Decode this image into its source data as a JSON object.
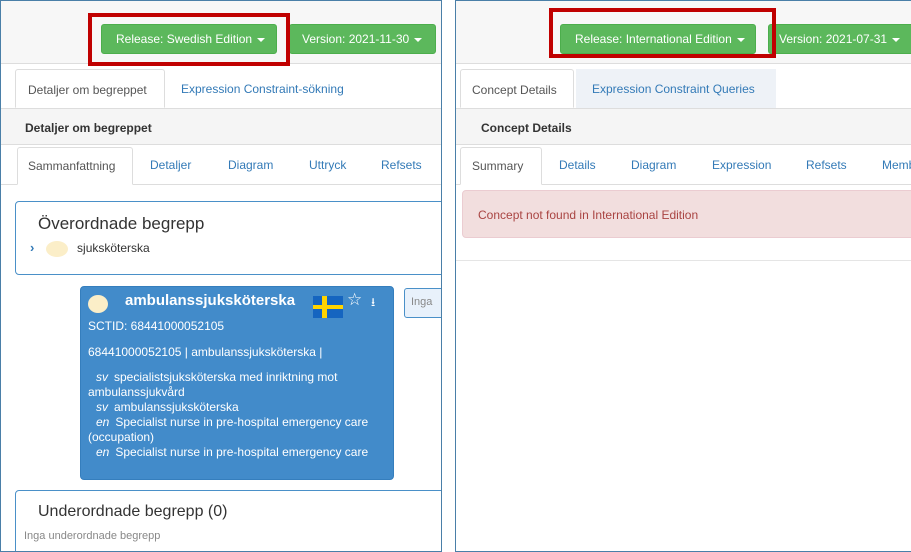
{
  "left": {
    "release_button": "Release: Swedish Edition",
    "version_button": "Version: 2021-11-30",
    "tabs": [
      "Detaljer om begreppet",
      "Expression Constraint-sökning"
    ],
    "section_header": "Detaljer om begreppet",
    "subtabs": [
      "Sammanfattning",
      "Detaljer",
      "Diagram",
      "Uttryck",
      "Refsets"
    ],
    "parents_title": "Överordnade begrepp",
    "parent_item": "sjuksköterska",
    "concept": {
      "name": "ambulanssjuksköterska",
      "sctid": "SCTID: 68441000052105",
      "fsn_line": "68441000052105 | ambulanssjuksköterska |",
      "descriptions": [
        {
          "lang": "sv",
          "text": "specialistsjuksköterska med inriktning mot ambulanssjukvård"
        },
        {
          "lang": "sv",
          "text": "ambulanssjuksköterska"
        },
        {
          "lang": "en",
          "text": "Specialist nurse in pre-hospital emergency care (occupation)"
        },
        {
          "lang": "en",
          "text": "Specialist nurse in pre-hospital emergency care"
        }
      ]
    },
    "side_button": "Inga",
    "children_title": "Underordnade begrepp (0)",
    "children_empty": "Inga underordnade begrepp"
  },
  "right": {
    "release_button": "Release: International Edition",
    "version_button": "Version: 2021-07-31",
    "tabs": [
      "Concept Details",
      "Expression Constraint Queries"
    ],
    "section_header": "Concept Details",
    "subtabs": [
      "Summary",
      "Details",
      "Diagram",
      "Expression",
      "Refsets",
      "Memb"
    ],
    "alert": "Concept not found in International Edition"
  },
  "colors": {
    "release_green": "#5cb85c",
    "highlight_red": "#c00000",
    "concept_blue": "#428bca",
    "alert_bg": "#f2dede",
    "alert_text": "#a94442",
    "link_blue": "#337ab7"
  }
}
